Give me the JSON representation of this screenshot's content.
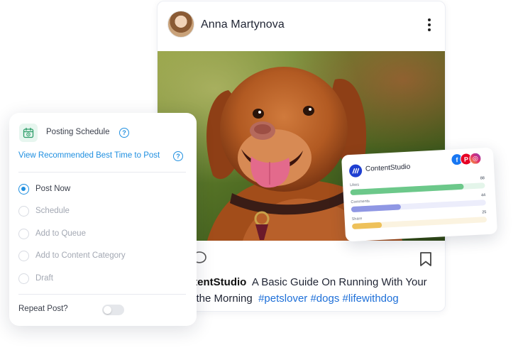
{
  "post": {
    "author": "Anna Martynova",
    "caption_brand": "ntentStudio",
    "caption_text_line1": "A Basic Guide On Running With Your",
    "caption_text_line2": "n the Morning",
    "hashtags": "#petslover #dogs #lifewithdog",
    "icons": [
      "avatar",
      "more-vertical-icon",
      "comment-icon",
      "bookmark-icon"
    ]
  },
  "schedule": {
    "title": "Posting Schedule",
    "best_time_link": "View Recommended Best Time to Post",
    "help_glyph": "?",
    "options": [
      {
        "label": "Post Now",
        "selected": true
      },
      {
        "label": "Schedule",
        "selected": false
      },
      {
        "label": "Add to Queue",
        "selected": false
      },
      {
        "label": "Add to Content Category",
        "selected": false
      },
      {
        "label": "Draft",
        "selected": false
      }
    ],
    "repeat_label": "Repeat Post?",
    "repeat_enabled": false
  },
  "analytics": {
    "brand": "ContentStudio",
    "social_icons": [
      "facebook-icon",
      "pinterest-icon",
      "instagram-icon"
    ],
    "social_glyphs": {
      "facebook": "f",
      "pinterest": "P",
      "instagram": "◎"
    },
    "metrics": [
      {
        "label": "Likes",
        "value": "88",
        "fill": 0.84,
        "color": "#6cc88a",
        "track": "#e4f5ea"
      },
      {
        "label": "Comments",
        "value": "44",
        "fill": 0.37,
        "color": "#8f97e4",
        "track": "#ecedfb"
      },
      {
        "label": "Share",
        "value": "25",
        "fill": 0.22,
        "color": "#eec15a",
        "track": "#fbf3e0"
      }
    ]
  },
  "colors": {
    "accent": "#1f8fe0",
    "hashtag": "#1d6fd8",
    "brand_blue": "#1f3fd1"
  }
}
